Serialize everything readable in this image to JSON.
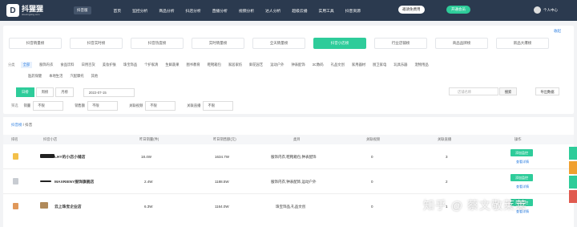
{
  "header": {
    "logo_mark": "D",
    "logo_name": "抖猩猩",
    "logo_sub": "douxingxing.com",
    "region": "抖音版",
    "nav": [
      "首页",
      "监控分析",
      "商品分析",
      "抖店分析",
      "直播分析",
      "视频分析",
      "达人分析",
      "超级云播",
      "实用工具",
      "抖音资源"
    ],
    "invite": "邀请免费用",
    "vip": "开通会员",
    "user": "个人中心"
  },
  "filters": {
    "collapse": "收起",
    "categories": [
      "抖音销量榜",
      "抖音实时榜",
      "抖音热度榜",
      "实时销量榜",
      "全天销量榜",
      "抖音小店榜",
      "行业店铺榜",
      "商品品牌榜",
      "新品大爆榜"
    ],
    "active_category": 5,
    "category_label": "分类",
    "subcats_row1": [
      "全部",
      "服饰内衣",
      "食品饮料",
      "日用百货",
      "美妆护肤",
      "珠宝饰品",
      "个护家清",
      "生鲜蔬果",
      "图书教育",
      "鞋靴箱包",
      "家居家纺",
      "鲜花园艺",
      "运动户外",
      "钟表配饰",
      "3C数码",
      "礼品文创",
      "家用器材",
      "厨卫家电",
      "玩具乐器",
      "宠物用品"
    ],
    "subcats_row2": [
      "医药保健",
      "本地生活",
      "汽配摩托",
      "其他"
    ],
    "periods": [
      "日榜",
      "周榜",
      "月榜"
    ],
    "date": "2022-07-15",
    "search_placeholder": "店铺名称",
    "search_btn": "搜索",
    "export": "导出数据",
    "filter_label": "筛选",
    "sel1_label": "销量",
    "sel1_value": "不限",
    "sel2_label": "销售额",
    "sel2_value": "不限",
    "sel3_label": "关联视频",
    "sel3_value": "不限",
    "sel4_label": "关联直播",
    "sel4_value": "不限"
  },
  "table": {
    "crumb_home": "抖音榜",
    "crumb_current": "抖音",
    "headers": [
      "排名",
      "抖音小店",
      "昨日销量(件)",
      "昨日销售额(元)",
      "类目",
      "关联视频",
      "关联直播",
      "操作"
    ],
    "rows": [
      {
        "shop": "LHY的小店小铺店",
        "sales": "18.4W",
        "revenue": "1634.7W",
        "category": "服饰内衣,鞋靴箱包,钟表配饰",
        "videos": "0",
        "lives": "3",
        "op": "添加监控",
        "detail": "查看详情"
      },
      {
        "shop": "MAXRIENY服饰旗舰店",
        "sales": "2.4W",
        "revenue": "1188.5W",
        "category": "服饰内衣,钟表配饰,运动户外",
        "videos": "0",
        "lives": "2",
        "op": "添加监控",
        "detail": "查看详情"
      },
      {
        "shop": "云上珠宝企业店",
        "sales": "6.3W",
        "revenue": "1164.0W",
        "category": "珠宝饰品,礼品文创",
        "videos": "0",
        "lives": "1",
        "op": "添加监控",
        "detail": "查看详情"
      }
    ]
  },
  "watermark": "知乎 @ 蔡文敬莱莱"
}
